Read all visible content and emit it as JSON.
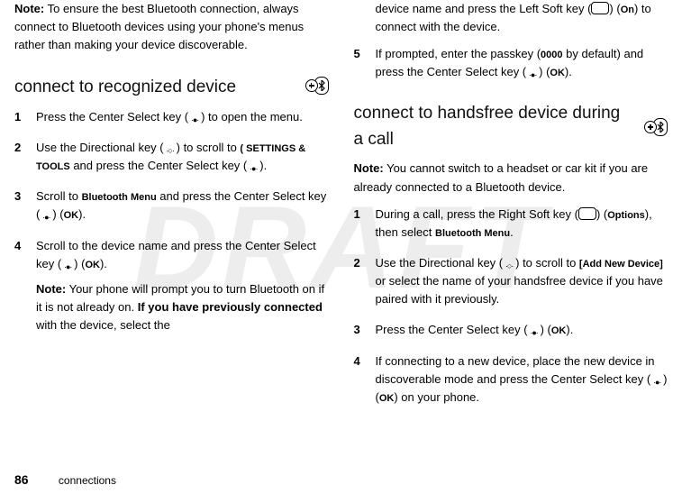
{
  "watermark": "DRAFT",
  "footer": {
    "page": "86",
    "section": "connections"
  },
  "left": {
    "intro": {
      "label": "Note:",
      "text": " To ensure the best Bluetooth connection, always connect to Bluetooth devices using your phone's menus rather than making your device discoverable."
    },
    "heading": "connect to recognized device",
    "steps": [
      {
        "n": "1",
        "pre": "Press the Center Select key (",
        "post": ") to open the menu."
      },
      {
        "n": "2",
        "pre": "Use the Directional key (",
        "mid1": ") to scroll to ",
        "settings": "SETTINGS & TOOLS",
        "mid2": " and press the Center Select key (",
        "post": ")."
      },
      {
        "n": "3",
        "pre": "Scroll to ",
        "menu": "Bluetooth Menu",
        "mid1": " and press the Center Select key (",
        "ok": "OK",
        "post": ")."
      },
      {
        "n": "4",
        "pre": "Scroll to the device name and press the Center Select key (",
        "ok": "OK",
        "post": ").",
        "note": {
          "label": "Note:",
          "t1": " Your phone will prompt you to turn Bluetooth on if it is not already on. ",
          "bold": "If you have previously connected",
          "t2": " with the device, select the"
        }
      }
    ]
  },
  "right": {
    "cont": {
      "pre": "device name and press the Left Soft key (",
      "on": "On",
      "post": ") to connect with the device."
    },
    "step5": {
      "n": "5",
      "pre": "If prompted, enter the passkey (",
      "pass": "0000",
      "mid": " by default) and press the Center Select key (",
      "ok": "OK",
      "post": ")."
    },
    "heading": "connect to handsfree device during a call",
    "note": {
      "label": "Note:",
      "text": " You cannot switch to a headset or car kit if you are already connected to a Bluetooth device."
    },
    "steps": [
      {
        "n": "1",
        "pre": "During a call, press the Right Soft key (",
        "opt": "Options",
        "mid": "), then select ",
        "menu": "Bluetooth Menu",
        "post": "."
      },
      {
        "n": "2",
        "pre": "Use the Directional key (",
        "mid1": ") to scroll to ",
        "add": "[Add New Device]",
        "post": " or select the name of your handsfree device if you have paired with it previously."
      },
      {
        "n": "3",
        "pre": "Press the Center Select key (",
        "ok": "OK",
        "post": ")."
      },
      {
        "n": "4",
        "pre": "If connecting to a new device, place the new device in discoverable mode and press the Center Select key (",
        "ok": "OK",
        "post": ") on your phone."
      }
    ]
  }
}
